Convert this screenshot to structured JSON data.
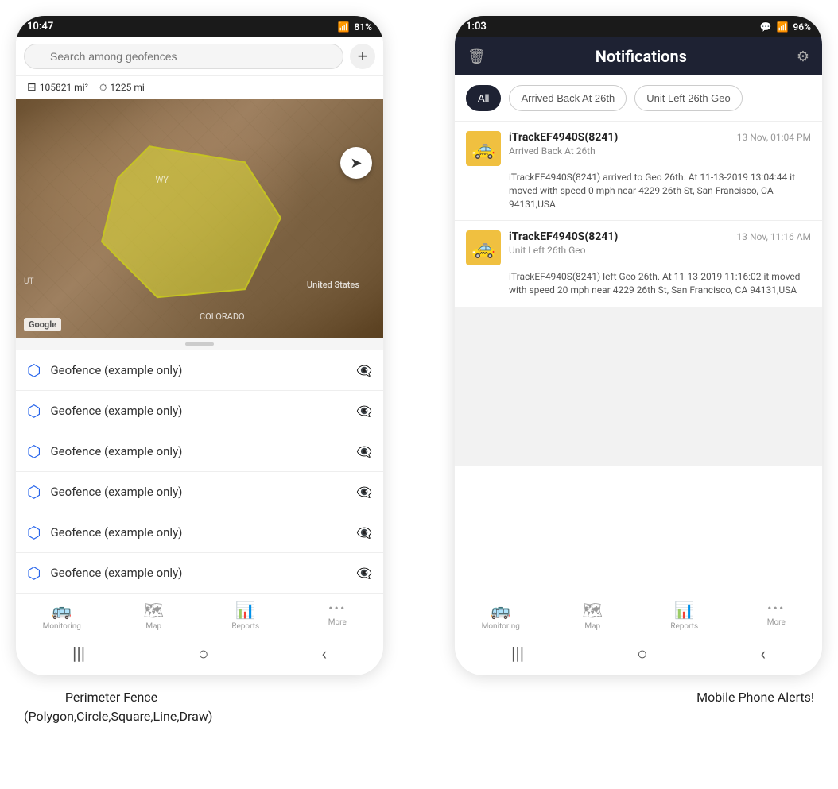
{
  "left_phone": {
    "status_bar": {
      "time": "10:47",
      "battery": "81%"
    },
    "search_placeholder": "Search among geofences",
    "stats": {
      "area": "105821 mi²",
      "distance": "1225 mi"
    },
    "map_labels": {
      "google": "Google",
      "us": "United States",
      "colorado": "COLORADO",
      "wyoming": "WY",
      "utah": "UT"
    },
    "geofence_items": [
      {
        "label": "Geofence (example only)"
      },
      {
        "label": "Geofence (example only)"
      },
      {
        "label": "Geofence (example only)"
      },
      {
        "label": "Geofence (example only)"
      },
      {
        "label": "Geofence (example only)"
      },
      {
        "label": "Geofence (example only)"
      }
    ],
    "nav_items": [
      {
        "icon": "🚌",
        "label": "Monitoring"
      },
      {
        "icon": "🗺",
        "label": "Map"
      },
      {
        "icon": "📊",
        "label": "Reports"
      },
      {
        "icon": "···",
        "label": "More"
      }
    ]
  },
  "right_phone": {
    "status_bar": {
      "time": "1:03",
      "battery": "96%"
    },
    "header_title": "Notifications",
    "filter_tabs": [
      {
        "label": "All",
        "active": true
      },
      {
        "label": "Arrived Back At 26th",
        "active": false
      },
      {
        "label": "Unit Left 26th Geo",
        "active": false
      }
    ],
    "notifications": [
      {
        "device": "iTrackEF4940S(8241)",
        "time": "13 Nov, 01:04 PM",
        "subtitle": "Arrived Back At 26th",
        "body": "iTrackEF4940S(8241) arrived to Geo 26th.   At 11-13-2019 13:04:44 it moved with speed 0 mph near 4229 26th St, San Francisco, CA 94131,USA"
      },
      {
        "device": "iTrackEF4940S(8241)",
        "time": "13 Nov, 11:16 AM",
        "subtitle": "Unit Left 26th Geo",
        "body": "iTrackEF4940S(8241) left Geo 26th.   At 11-13-2019 11:16:02 it moved with speed 20 mph near 4229 26th St, San Francisco, CA 94131,USA"
      }
    ],
    "nav_items": [
      {
        "icon": "🚌",
        "label": "Monitoring"
      },
      {
        "icon": "🗺",
        "label": "Map"
      },
      {
        "icon": "📊",
        "label": "Reports"
      },
      {
        "icon": "···",
        "label": "More"
      }
    ]
  },
  "captions": {
    "left": "Perimeter Fence\n(Polygon,Circle,Square,Line,Draw)",
    "right": "Mobile Phone Alerts!"
  }
}
